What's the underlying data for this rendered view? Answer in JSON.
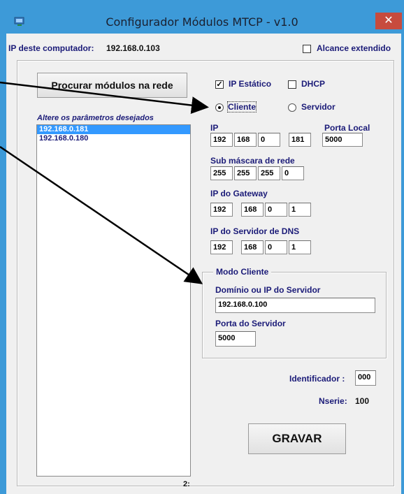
{
  "window": {
    "title": "Configurador Módulos MTCP - v1.0",
    "close_glyph": "✕",
    "accent_color": "#3d9ad8",
    "app_icon": "network-monitor-icon"
  },
  "header": {
    "ip_label": "IP deste computador:",
    "ip_value": "192.168.0.103",
    "extended_range_label": "Alcance extendido",
    "extended_range_checked": false
  },
  "left": {
    "search_button": "Procurar módulos na rede",
    "list_caption": "Altere os parâmetros desejados",
    "modules": [
      {
        "ip": "192.168.0.181",
        "selected": true
      },
      {
        "ip": "192.168.0.180",
        "selected": false
      }
    ],
    "count": "2:"
  },
  "config": {
    "static_ip_label": "IP Estático",
    "static_ip_checked": true,
    "dhcp_label": "DHCP",
    "dhcp_checked": false,
    "client_label": "Cliente",
    "server_label": "Servidor",
    "mode_selected": "Cliente",
    "ip_label": "IP",
    "ip": [
      "192",
      "168",
      "0",
      "181"
    ],
    "local_port_label": "Porta Local",
    "local_port": "5000",
    "subnet_label": "Sub máscara de rede",
    "subnet": [
      "255",
      "255",
      "255",
      "0"
    ],
    "gateway_label": "IP do Gateway",
    "gateway": [
      "192",
      "168",
      "0",
      "1"
    ],
    "dns_label": "IP do Servidor de DNS",
    "dns": [
      "192",
      "168",
      "0",
      "1"
    ]
  },
  "client_mode": {
    "title": "Modo Cliente",
    "server_address_label": "Domínio ou IP do Servidor",
    "server_address": "192.168.0.100",
    "server_port_label": "Porta do Servidor",
    "server_port": "5000"
  },
  "footer": {
    "identifier_label": "Identificador :",
    "identifier": "000",
    "serial_label": "Nserie:",
    "serial": "100",
    "save_button": "GRAVAR"
  }
}
